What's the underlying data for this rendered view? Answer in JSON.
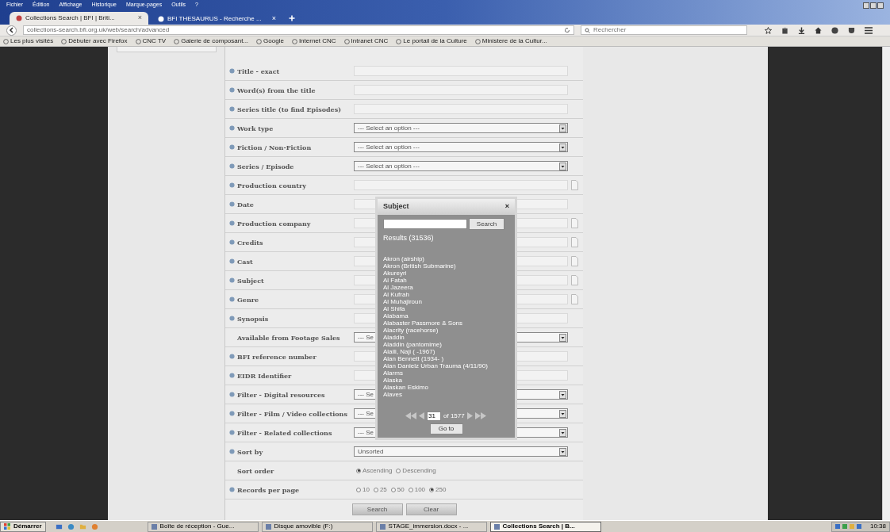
{
  "menu_bar": [
    "Fichier",
    "Édition",
    "Affichage",
    "Historique",
    "Marque-pages",
    "Outils",
    "?"
  ],
  "tabs": [
    {
      "label": "Collections Search | BFI | Briti...",
      "close": "×",
      "selected": true
    },
    {
      "label": "BFI THESAURUS - Recherche ...",
      "close": "×",
      "selected": false
    }
  ],
  "address_bar": {
    "url": "collections-search.bfi.org.uk/web/search/advanced"
  },
  "search_bar": {
    "placeholder": "Rechercher"
  },
  "bookmarks": [
    "Les plus visités",
    "Débuter avec Firefox",
    "CNC TV",
    "Galerie de composant...",
    "Google",
    "Internet CNC",
    "Intranet CNC",
    "Le portail de la Culture",
    "Ministere de la Cultur..."
  ],
  "form": {
    "rows": [
      {
        "label": "Title - exact",
        "help_icon": true,
        "kind": "text"
      },
      {
        "label": "Word(s) from the title",
        "help_icon": true,
        "kind": "text"
      },
      {
        "label": "Series title (to find Episodes)",
        "help_icon": true,
        "kind": "text"
      },
      {
        "label": "Work type",
        "help_icon": true,
        "kind": "select",
        "value": "--- Select an option ---"
      },
      {
        "label": "Fiction / Non-Fiction",
        "help_icon": true,
        "kind": "select",
        "value": "--- Select an option ---"
      },
      {
        "label": "Series / Episode",
        "help_icon": true,
        "kind": "select",
        "value": "--- Select an option ---"
      },
      {
        "label": "Production country",
        "help_icon": true,
        "kind": "lookup"
      },
      {
        "label": "Date",
        "help_icon": true,
        "kind": "text"
      },
      {
        "label": "Production company",
        "help_icon": true,
        "kind": "lookup"
      },
      {
        "label": "Credits",
        "help_icon": true,
        "kind": "lookup"
      },
      {
        "label": "Cast",
        "help_icon": true,
        "kind": "lookup"
      },
      {
        "label": "Subject",
        "help_icon": true,
        "kind": "lookup"
      },
      {
        "label": "Genre",
        "help_icon": true,
        "kind": "lookup"
      },
      {
        "label": "Synopsis",
        "help_icon": true,
        "kind": "text"
      },
      {
        "label": "Available from Footage Sales",
        "help_icon": false,
        "kind": "select",
        "value": "--- Se"
      },
      {
        "label": "BFI reference number",
        "help_icon": true,
        "kind": "text"
      },
      {
        "label": "EIDR Identifier",
        "help_icon": true,
        "kind": "text"
      },
      {
        "label": "Filter - Digital resources",
        "help_icon": true,
        "kind": "select",
        "value": "--- Se"
      },
      {
        "label": "Filter - Film / Video collections",
        "help_icon": true,
        "kind": "select",
        "value": "--- Se"
      },
      {
        "label": "Filter - Related collections",
        "help_icon": true,
        "kind": "select",
        "value": "--- Se"
      },
      {
        "label": "Sort by",
        "help_icon": true,
        "kind": "select",
        "value": "Unsorted"
      },
      {
        "label": "Sort order",
        "help_icon": false,
        "kind": "radio",
        "options": [
          {
            "label": "Ascending",
            "selected": true
          },
          {
            "label": "Descending",
            "selected": false
          }
        ]
      },
      {
        "label": "Records per page",
        "help_icon": true,
        "kind": "radio",
        "options": [
          {
            "label": "10",
            "selected": false
          },
          {
            "label": "25",
            "selected": false
          },
          {
            "label": "50",
            "selected": false
          },
          {
            "label": "100",
            "selected": false
          },
          {
            "label": "250",
            "selected": true
          }
        ]
      }
    ],
    "buttons": [
      "Search",
      "Clear"
    ]
  },
  "popup": {
    "title": "Subject",
    "close": "×",
    "search_button": "Search",
    "results": "Results (31536)",
    "items": [
      "Akron (airship)",
      "Akron (British Submarine)",
      "Akureyri",
      "Al Fatah",
      "Al Jazeera",
      "Al Kufrah",
      "Al Muhajiroun",
      "Al Shifa",
      "Alabama",
      "Alabaster Passmore & Sons",
      "Alacrity (racehorse)",
      "Aladdin",
      "Aladdin (pantomime)",
      "Alaili, Naji ( -1967)",
      "Alan Bennett (1934- )",
      "Alan Danielz Urban Trauma (4/11/90)",
      "Alarms",
      "Alaska",
      "Alaskan Eskimo",
      "Alaves"
    ],
    "page": "31",
    "page_total": "of 1577",
    "goto_button": "Go to"
  },
  "taskbar": {
    "start": "Démarrer",
    "windows": [
      {
        "label": "Boîte de réception - Gue...",
        "selected": false
      },
      {
        "label": "Disque amovible (F:)",
        "selected": false
      },
      {
        "label": "STAGE_immersion.docx - ...",
        "selected": false
      },
      {
        "label": "Collections Search | B...",
        "selected": true
      }
    ],
    "clock": "10:38"
  }
}
